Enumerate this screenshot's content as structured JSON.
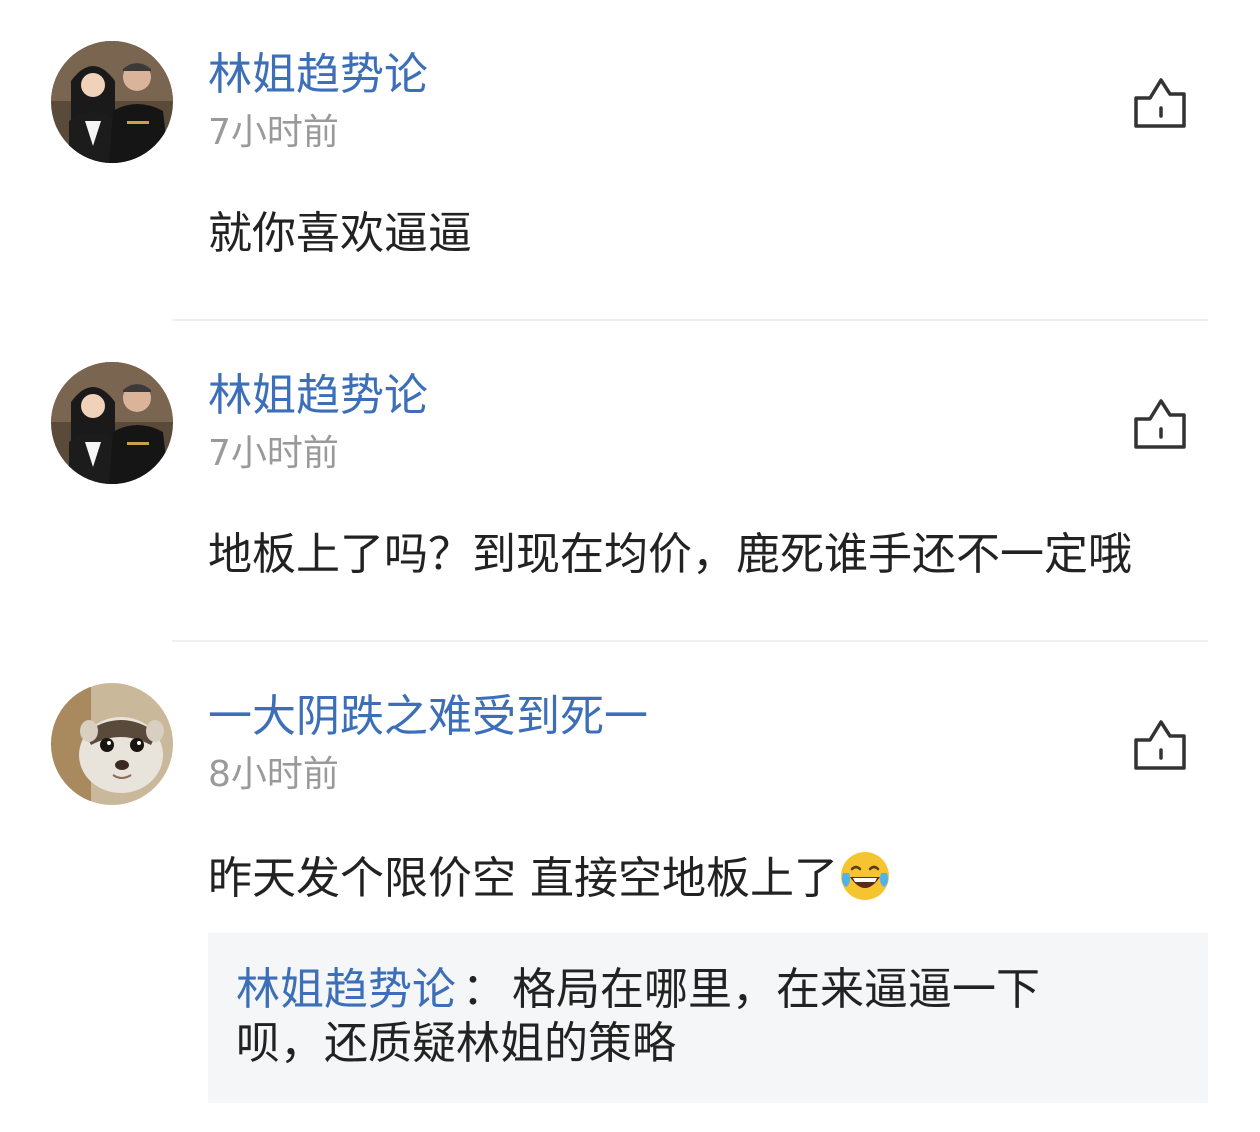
{
  "comments": [
    {
      "username": "林姐趋势论",
      "time": "7小时前",
      "text": "就你喜欢逼逼"
    },
    {
      "username": "林姐趋势论",
      "time": "7小时前",
      "text": "地板上了吗？到现在均价，鹿死谁手还不一定哦"
    },
    {
      "username": "一大阴跌之难受到死一",
      "time": "8小时前",
      "text": "昨天发个限价空  直接空地板上了",
      "text_emoji": "laughing-with-tears-emoji",
      "reply": {
        "author": "林姐趋势论",
        "separator": "：",
        "text_line1": "格局在哪里，在来逼逼一下",
        "text_line2": "呗，还质疑林姐的策略"
      }
    }
  ],
  "icons": {
    "like": "thumbs-up-icon",
    "avatar_1": "avatar-photo",
    "avatar_3": "ferret-avatar-photo"
  },
  "colors": {
    "username": "#3d6fb8",
    "timestamp": "#9a9a9a",
    "text": "#222222",
    "reply_bg": "#f5f6f7",
    "divider": "#efefef"
  }
}
